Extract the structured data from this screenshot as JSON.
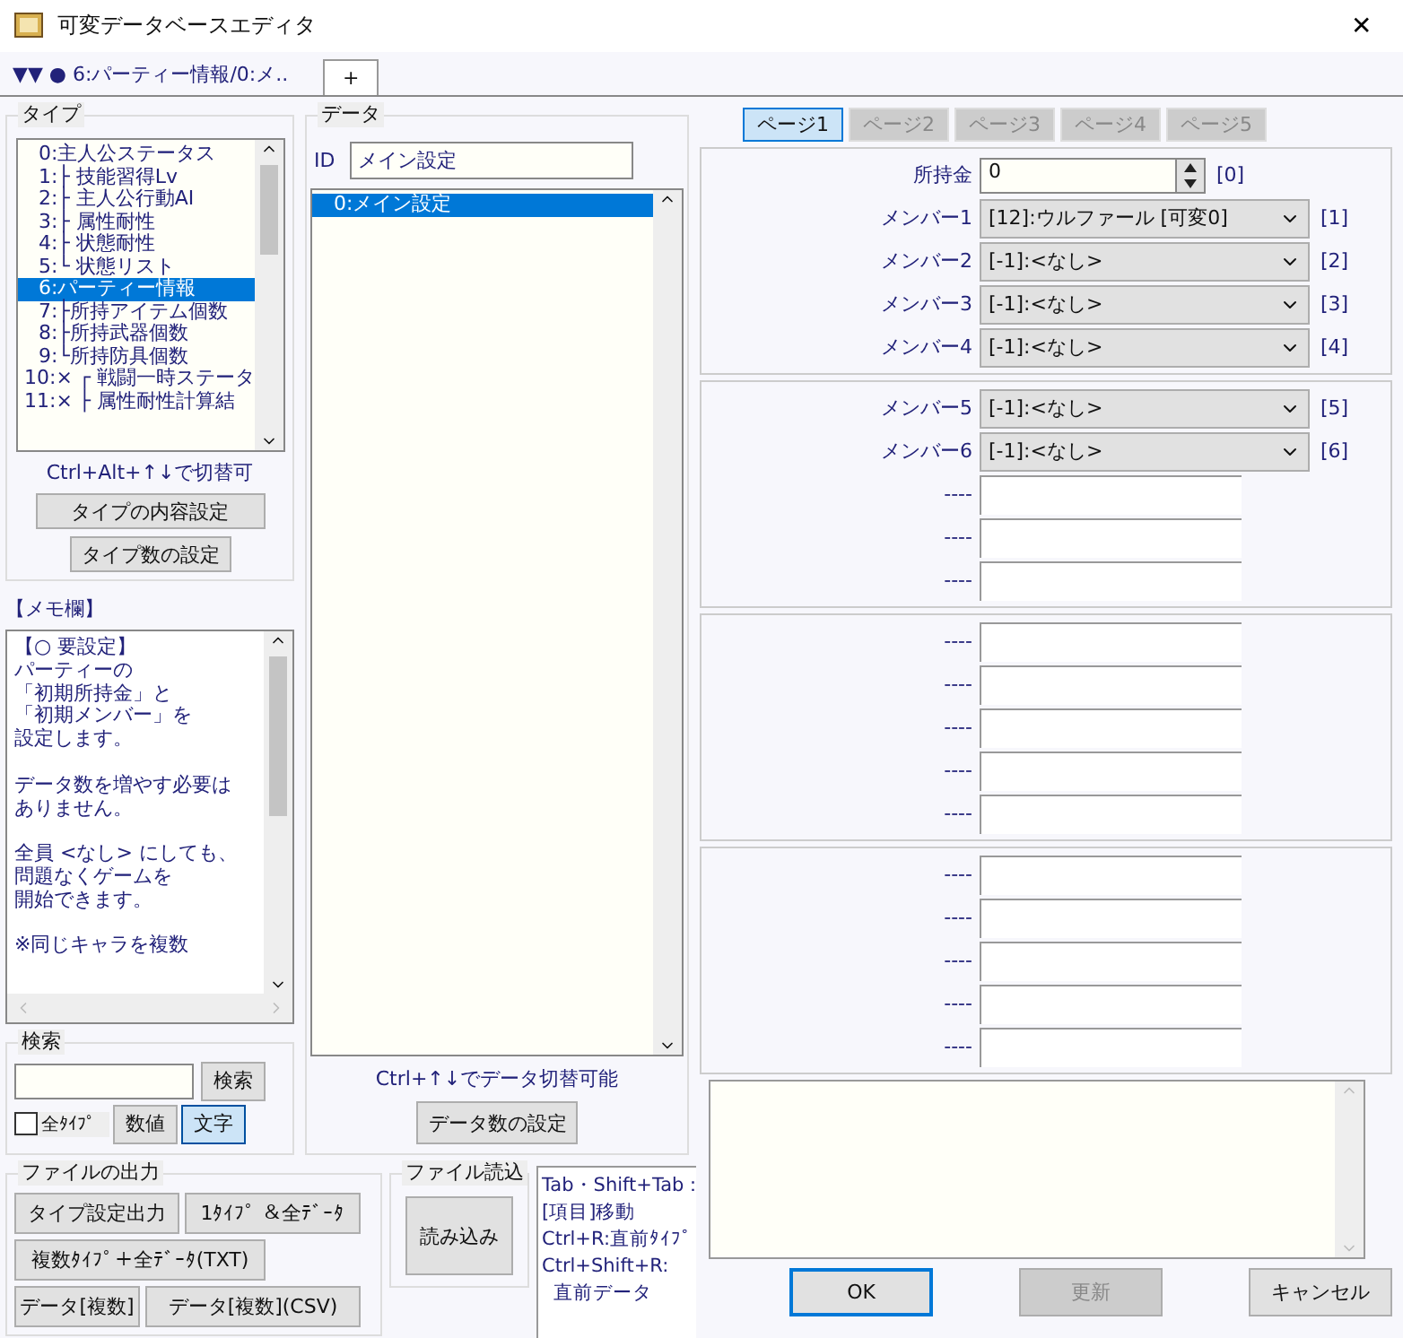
{
  "window": {
    "title": "可変データベースエディタ",
    "close": "✕"
  },
  "tabs": [
    {
      "label": "▼▼ ● 6:パーティー情報/0:メ..",
      "selected": true
    },
    {
      "label": "+",
      "selected": false
    }
  ],
  "type_group": {
    "title": "タイプ",
    "items": [
      {
        "label": "0:主人公ステータス",
        "selected": false
      },
      {
        "label": "1:├ 技能習得Lv",
        "selected": false
      },
      {
        "label": "2:├ 主人公行動AI",
        "selected": false
      },
      {
        "label": "3:├ 属性耐性",
        "selected": false
      },
      {
        "label": "4:├ 状態耐性",
        "selected": false
      },
      {
        "label": "5:└ 状態リスト",
        "selected": false
      },
      {
        "label": "6:パーティー情報",
        "selected": true
      },
      {
        "label": "7:├所持アイテム個数",
        "selected": false
      },
      {
        "label": "8:├所持武器個数",
        "selected": false
      },
      {
        "label": "9:└所持防具個数",
        "selected": false
      },
      {
        "label": "10:× ┌ 戦闘一時ステータ",
        "selected": false
      },
      {
        "label": "11:× ├ 属性耐性計算結",
        "selected": false
      }
    ],
    "hint": "Ctrl+Alt+↑↓で切替可",
    "buttons": [
      "タイプの内容設定",
      "タイプ数の設定"
    ]
  },
  "memo": {
    "title": "【メモ欄】",
    "paragraphs": [
      [
        "【○ 要設定】",
        "パーティーの",
        "「初期所持金」と",
        "「初期メンバー」を",
        "設定します。"
      ],
      [
        "データ数を増やす必要は",
        "ありません。"
      ],
      [
        "全員 <なし> にしても、",
        "問題なくゲームを",
        "開始できます。"
      ],
      [
        "※同じキャラを複数"
      ]
    ]
  },
  "search": {
    "title": "検索",
    "button": "検索",
    "all_types": {
      "label": "全ﾀｲﾌﾟ",
      "checked": false
    },
    "modes": [
      {
        "label": "数値",
        "selected": false
      },
      {
        "label": "文字",
        "selected": true
      }
    ]
  },
  "file_output": {
    "title": "ファイルの出力",
    "buttons": [
      "タイプ設定出力",
      "1ﾀｲﾌﾟ ＆全ﾃﾞｰﾀ",
      "複数ﾀｲﾌﾟ＋全ﾃﾞｰﾀ(TXT)",
      "データ[複数]",
      "データ[複数](CSV)"
    ]
  },
  "file_input": {
    "title": "ファイル読込",
    "button": "読み込み"
  },
  "help": "Tab・Shift+Tab：\n[項目]移動\nCtrl+R:直前ﾀｲﾌﾟ\nCtrl+Shift+R:\n  直前データ",
  "data": {
    "title": "データ",
    "id_label": "ID",
    "id_value": "メイン設定",
    "items": [
      {
        "label": "0:メイン設定",
        "selected": true
      }
    ],
    "hint": "Ctrl+↑↓でデータ切替可能",
    "button": "データ数の設定"
  },
  "pages": [
    {
      "label": "ページ1",
      "selected": true,
      "disabled": false
    },
    {
      "label": "ページ2",
      "selected": false,
      "disabled": true
    },
    {
      "label": "ページ3",
      "selected": false,
      "disabled": true
    },
    {
      "label": "ページ4",
      "selected": false,
      "disabled": true
    },
    {
      "label": "ページ5",
      "selected": false,
      "disabled": true
    }
  ],
  "panels": [
    {
      "rows": [
        {
          "kind": "spin",
          "label": "所持金",
          "value": "0",
          "index": "[0]"
        },
        {
          "kind": "select",
          "label": "メンバー1",
          "value": "[12]:ウルファール [可変0]",
          "index": "[1]"
        },
        {
          "kind": "select",
          "label": "メンバー2",
          "value": "[-1]:<なし>",
          "index": "[2]"
        },
        {
          "kind": "select",
          "label": "メンバー3",
          "value": "[-1]:<なし>",
          "index": "[3]"
        },
        {
          "kind": "select",
          "label": "メンバー4",
          "value": "[-1]:<なし>",
          "index": "[4]"
        }
      ]
    },
    {
      "rows": [
        {
          "kind": "select",
          "label": "メンバー5",
          "value": "[-1]:<なし>",
          "index": "[5]"
        },
        {
          "kind": "select",
          "label": "メンバー6",
          "value": "[-1]:<なし>",
          "index": "[6]"
        },
        {
          "kind": "blank",
          "label": "----"
        },
        {
          "kind": "blank",
          "label": "----"
        },
        {
          "kind": "blank",
          "label": "----"
        }
      ]
    },
    {
      "rows": [
        {
          "kind": "blank",
          "label": "----"
        },
        {
          "kind": "blank",
          "label": "----"
        },
        {
          "kind": "blank",
          "label": "----"
        },
        {
          "kind": "blank",
          "label": "----"
        },
        {
          "kind": "blank",
          "label": "----"
        }
      ]
    },
    {
      "rows": [
        {
          "kind": "blank",
          "label": "----"
        },
        {
          "kind": "blank",
          "label": "----"
        },
        {
          "kind": "blank",
          "label": "----"
        },
        {
          "kind": "blank",
          "label": "----"
        },
        {
          "kind": "blank",
          "label": "----"
        }
      ]
    }
  ],
  "buttons": [
    {
      "label": "OK",
      "disabled": false,
      "focused": true
    },
    {
      "label": "更新",
      "disabled": true,
      "focused": false
    },
    {
      "label": "キャンセル",
      "disabled": false,
      "focused": false
    }
  ]
}
